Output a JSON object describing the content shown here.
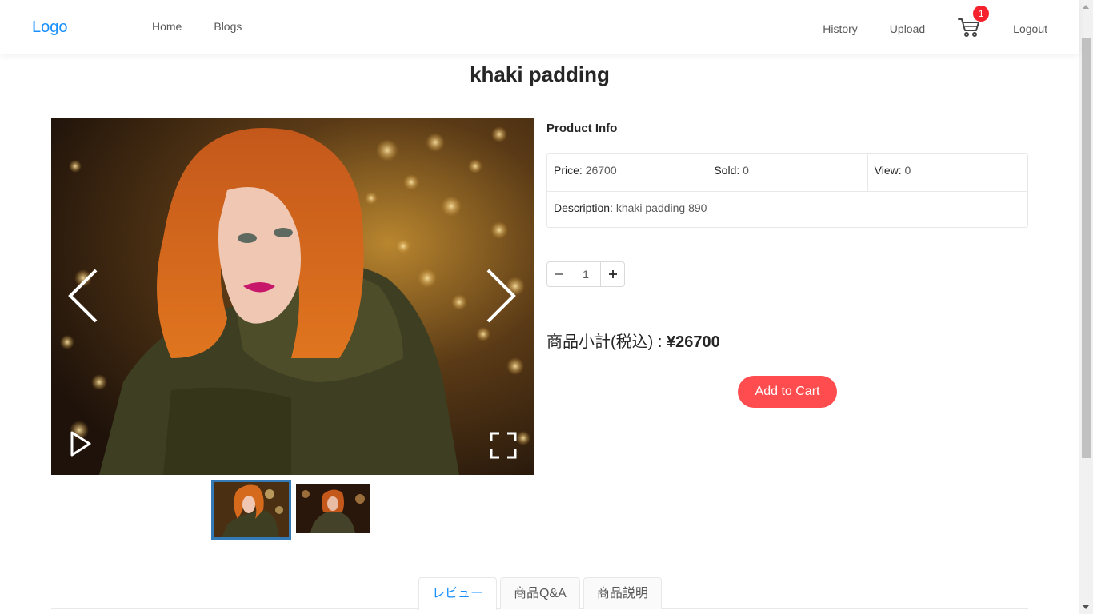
{
  "header": {
    "logo": "Logo",
    "nav_left": [
      "Home",
      "Blogs"
    ],
    "nav_right": {
      "history": "History",
      "upload": "Upload",
      "logout": "Logout"
    },
    "cart_count": "1",
    "cart_icon": "shopping-cart-icon"
  },
  "product": {
    "title": "khaki padding",
    "info_title": "Product Info",
    "price_label": "Price:",
    "price_value": "26700",
    "sold_label": "Sold:",
    "sold_value": "0",
    "view_label": "View:",
    "view_value": "0",
    "description_label": "Description:",
    "description_value": "khaki padding 890",
    "quantity": "1",
    "subtotal_label": "商品小計(税込) : ",
    "subtotal_value": "¥26700",
    "add_to_cart": "Add to Cart"
  },
  "gallery": {
    "icons": [
      "chevron-left-icon",
      "chevron-right-icon",
      "play-icon",
      "fullscreen-icon"
    ],
    "thumbnail_count": 2,
    "active_thumbnail": 1
  },
  "tabs": [
    "レビュー",
    "商品Q&A",
    "商品説明"
  ],
  "active_tab": "レビュー",
  "colors": {
    "accent": "#1890ff",
    "add_to_cart": "#ff4d4f",
    "badge": "#f5222d",
    "thumbnail_border": "#337ab7"
  }
}
